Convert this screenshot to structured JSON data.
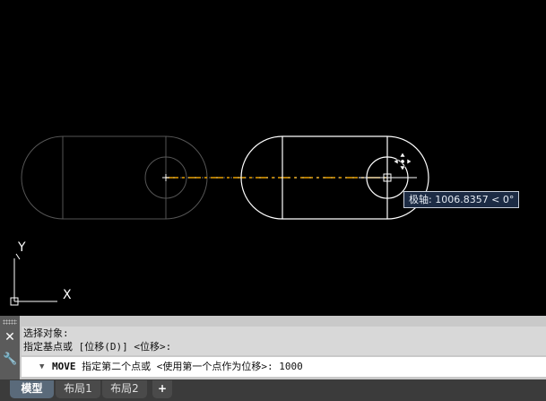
{
  "canvas": {
    "tooltip_text": "极轴: 1006.8357 < 0°",
    "ucs_icon": {
      "y_label": "Y",
      "x_label": "X"
    }
  },
  "command_line": {
    "close_icon": "close-icon",
    "settings_icon": "wrench-icon",
    "history": [
      "选择对象:",
      "指定基点或 [位移(D)] <位移>:"
    ],
    "prompt": {
      "command": "MOVE",
      "text": "指定第二个点或 <使用第一个点作为位移>:",
      "value": "1000"
    }
  },
  "tabs": {
    "model": "模型",
    "layout1": "布局1",
    "layout2": "布局2",
    "add": "+"
  },
  "colors": {
    "background": "#000000",
    "ghost_geometry": "#555555",
    "active_geometry": "#ffffff",
    "rubber_band": "#e8a000",
    "tooltip_bg": "#1c2b44"
  }
}
